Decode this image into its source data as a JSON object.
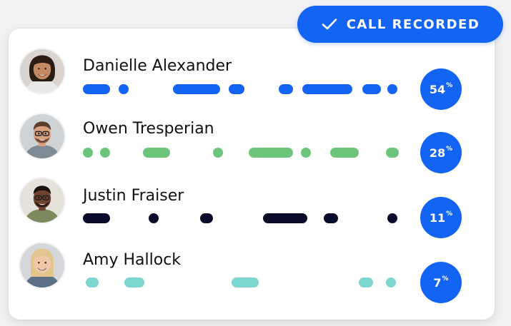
{
  "badge": {
    "label": "CALL RECORDED",
    "icon": "check-icon",
    "color": "#1464f4"
  },
  "participants": [
    {
      "name": "Danielle Alexander",
      "percent": "54",
      "percent_sign": "%",
      "color": "#1464f4",
      "avatar": {
        "skin": "#c48a62",
        "hair": "#2b1c14",
        "bg": "#d9d4cf",
        "shirt": "#e9e9e9"
      }
    },
    {
      "name": "Owen Tresperian",
      "percent": "28",
      "percent_sign": "%",
      "color": "#6cc57a",
      "avatar": {
        "skin": "#d9a07d",
        "hair": "#5a3f2c",
        "bg": "#cfd3d6",
        "shirt": "#7e8a95"
      }
    },
    {
      "name": "Justin Fraiser",
      "percent": "11",
      "percent_sign": "%",
      "color": "#0b0b2a",
      "avatar": {
        "skin": "#6d4330",
        "hair": "#1b120e",
        "bg": "#e5e2dc",
        "shirt": "#7b8b5d"
      }
    },
    {
      "name": "Amy Hallock",
      "percent": "7",
      "percent_sign": "%",
      "color": "#7ed6d0",
      "avatar": {
        "skin": "#efc7a9",
        "hair": "#e1c58d",
        "bg": "#d6d7da",
        "shirt": "#5b6f86"
      }
    }
  ]
}
